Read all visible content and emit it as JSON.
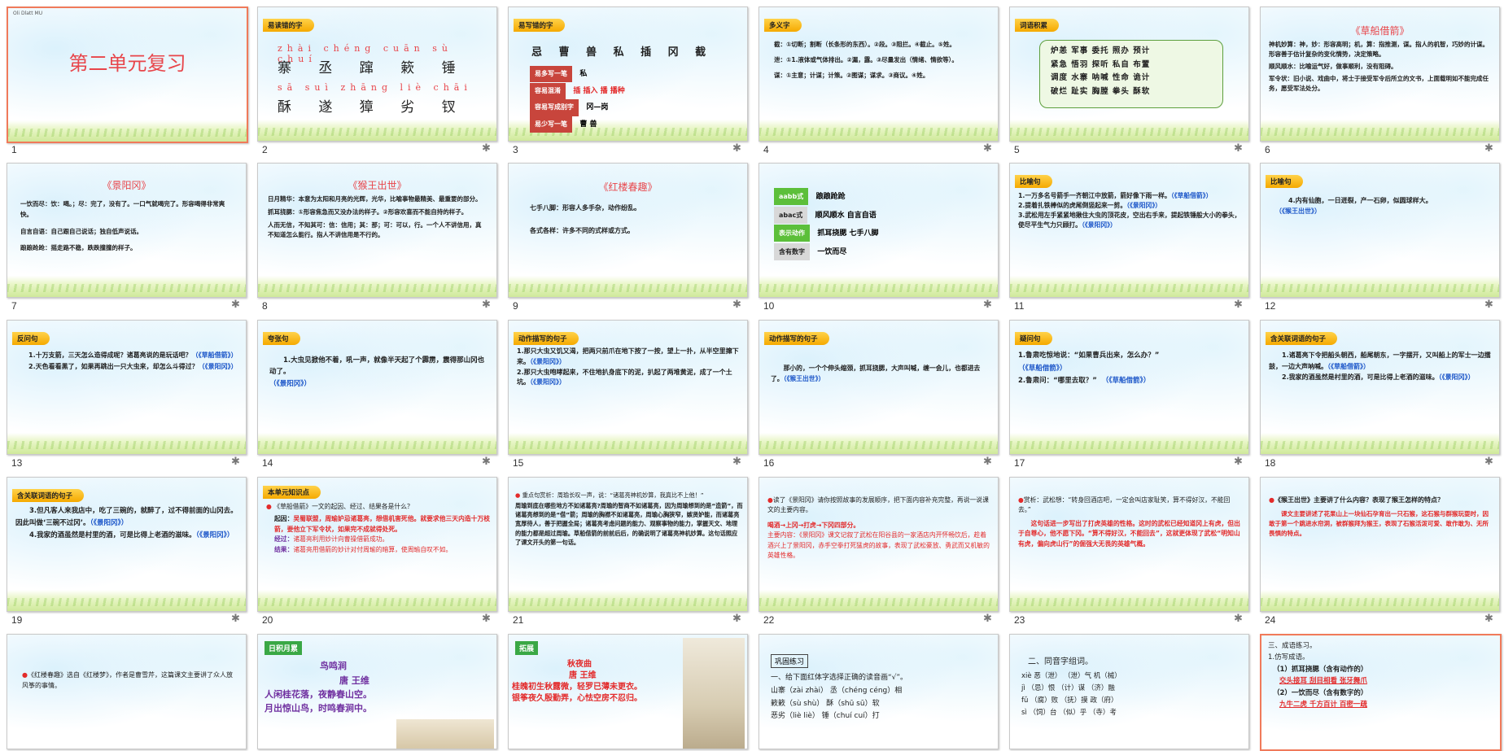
{
  "slides": [
    {
      "num": "1",
      "topline": "Oli  Dlatt  MU",
      "title": "第二单元复习"
    },
    {
      "num": "2",
      "tag": "易读错的字",
      "py1": "zhài  chéng cuān  sù   chuí",
      "ch1": "寨 丞 蹿 簌 锤",
      "py2": "sā   suì   zhāng   liè   chāi",
      "ch2": "酥 遂 獐 劣 钗"
    },
    {
      "num": "3",
      "tag": "易写错的字",
      "chars": "忌 曹 兽 私 插 冈 截",
      "rows": [
        {
          "label": "易多写一笔",
          "val": "私"
        },
        {
          "label": "容易混淆",
          "val": "插 插入  播 播种"
        },
        {
          "label": "容易写成别字",
          "val": "冈—岗"
        },
        {
          "label": "易少写一笔",
          "val": "曹  兽"
        }
      ]
    },
    {
      "num": "4",
      "tag": "多义字",
      "l1": "截：①切断；割断（长条形的东西）。②段。③阻拦。④截止。⑤姓。",
      "l2": "泄：①1.液体或气体排出。②漏，露。③尽量发出（情绪、情欲等）。",
      "l3": "谋：①主意；计谋；计策。②图谋；谋求。③商议。④姓。"
    },
    {
      "num": "5",
      "tag": "词语积累",
      "words": [
        "炉恙  军事  委托  照办  预计",
        "紧急  悟羽  探听  私自  布置",
        "调度  水寨  呐喊  性命  诡计",
        "破烂  趾实  胸膛  拳头  酥软"
      ]
    },
    {
      "num": "6",
      "title": "《草船借箭》",
      "p1": "神机妙算：神，妙：形容高明；机，算：指推测，谋。指人的机智，巧妙的计谋。形容善于估计复杂的变化情势，决定策略。",
      "p2": "顺风顺水：比喻运气好，做事顺利，没有阻碍。",
      "p3": "军令状：旧小说、戏曲中，将士于接受军令后所立的文书，上面载明如不能完成任务，愿受军法处分。"
    },
    {
      "num": "7",
      "title": "《景阳冈》",
      "p1": "一饮而尽：饮：喝。；尽：完了，没有了。一口气就喝完了。形容喝得非常爽快。",
      "p2": "自言自语：自己跟自己说话；独自低声说话。",
      "p3": "踉踉跄跄：摇走路不稳，跌跌撞撞的样子。"
    },
    {
      "num": "8",
      "title": "《猴王出世》",
      "p1": "日月精华：本意为太阳和月亮的光辉，光华，比喻事物最精美、最重要的部分。",
      "p2": "抓耳挠腮：①形容焦急而又没办法的样子。②形容欢喜而不能自持的样子。",
      "p3": "人而无信，不知其可：信：信用；其：那；可：可以，行。一个人不讲信用，真不知道怎么能行。指人不讲信用是不行的。"
    },
    {
      "num": "9",
      "title": "《红楼春趣》",
      "p1": "七手八脚：形容人多手杂，动作纷乱。",
      "p2": "各式各样：许多不同的式样或方式。"
    },
    {
      "num": "10",
      "rows": [
        {
          "label": "aabb式",
          "val": "踉踉跄跄"
        },
        {
          "label": "abac式",
          "val": "顺风顺水    自言自语"
        },
        {
          "label": "表示动作",
          "val": "抓耳挠腮    七手八脚"
        },
        {
          "label": "含有数字",
          "val": "一饮而尽"
        }
      ]
    },
    {
      "num": "11",
      "tag": "比喻句",
      "p1": "1.一万多名号箭手一齐朝江中放箭，箭好像下雨一样。",
      "s1": "（《草船借箭》）",
      "p2": "2.提着扎铁棒似的虎尾倒竖起来一剪。",
      "s2": "（《景阳冈》）",
      "p3": "3.武松用左手紧紧地揪住大虫的顶花皮，空出右手来，提起铁锤般大小的拳头，使尽平生气力只顾打。",
      "s3": "（《景阳冈》）"
    },
    {
      "num": "12",
      "tag": "比喻句",
      "p1": "4.内有仙胞，一日迸裂，产一石卵，似圆球样大。",
      "s1": "（《猴王出世》）"
    },
    {
      "num": "13",
      "tag": "反问句",
      "p1": "1.十万支箭，三天怎么造得成呢？诸葛亮说的是玩话吧？",
      "s1": "（《草船借箭》）",
      "p2": "2.天色看看黑了，如果再跳出一只大虫来，却怎么斗得过？",
      "s2": "（《景阳冈》）"
    },
    {
      "num": "14",
      "tag": "夸张句",
      "p1": "1.大虫见掀他不着，吼一声，就像半天起了个霹雳，震得那山冈也动了。",
      "s1": "（《景阳冈》）"
    },
    {
      "num": "15",
      "tag": "动作描写的句子",
      "p1": "1.那只大虫又饥又渴，把两只前爪在地下按了一按，望上一扑，从半空里撺下来。",
      "s1": "（《景阳冈》）",
      "p2": "2.那只大虫咆哮起来，不住地扒身底下的泥，扒起了两堆黄泥，成了一个土坑。",
      "s2": "（《景阳冈》）"
    },
    {
      "num": "16",
      "tag": "动作描写的句子",
      "p1": "那小的，一个个伸头缩颈，抓耳挠腮，大声叫喊，缠一会儿，也都进去了。",
      "s1": "（《猴王出世》）"
    },
    {
      "num": "17",
      "tag": "疑问句",
      "p1": "1.鲁肃吃惊地说：“如果曹兵出来，怎么办？”",
      "s1": "（《草船借箭》）",
      "p2": "2.鲁肃问：“哪里去取？”",
      "s2": "（《草船借箭》）"
    },
    {
      "num": "18",
      "tag": "含关联词语的句子",
      "p1": "1.诸葛亮下令把船头朝西，船尾朝东，一字摆开，又叫船上的军士一边擂鼓，一边大声呐喊。",
      "s1": "（《草船借箭》）",
      "p2": "2.我家的酒虽然是村里的酒，可是比得上老酒的滋味。",
      "s2": "（《景阳冈》）"
    },
    {
      "num": "19",
      "tag": "含关联词语的句子",
      "p1": "3.但凡客人来我店中，吃了三碗的，就醉了，过不得前面的山冈去。因此叫做‘三碗不过冈’。",
      "s1": "（《景阳冈》）",
      "p2": "4.我家的酒虽然是村里的酒，可是比得上老酒的滋味。",
      "s2": "（《景阳冈》）"
    },
    {
      "num": "20",
      "tag": "本单元知识点",
      "q": "《草船借箭》一文的起因、经过、结果各是什么？",
      "a1": "起因：",
      "a1v": "吴蜀联盟，周瑜妒忌诸葛亮，想借机害死他。就要求他三天内造十万枝箭，要他立下军令状，如果完不成就得处死。",
      "a2": "经过：",
      "a2v": "诸葛亮利用妙计向曹操借箭成功。",
      "a3": "结果：",
      "a3v": "诸葛亮用借箭的妙计对付周瑜的暗算，使周瑜自叹不如。"
    },
    {
      "num": "21",
      "p1": "重点句赏析：周瑜长叹一声，说：“诸葛亮神机妙算，我真比不上他！”",
      "p2": "周瑜到底在哪些地方不如诸葛亮?周瑜的智商不如诸葛亮，因为周瑜想到的是“造箭”，而诸葛亮想到的是“借”箭；周瑜的胸襟不如诸葛亮，周瑜心胸狭窄，嫉贤妒能，而诸葛亮宽厚待人，善于把握全局；诸葛亮考虑问题的能力、观察事物的能力，掌握天文、地理的能力都是超过周瑜。草船借箭的前前后后，的确说明了诸葛亮神机妙算。这句话照应了课文开头的第一句话。"
    },
    {
      "num": "22",
      "p1": "读了《景阳冈》请你按照故事的发展顺序，把下面内容补充完整，再说一说课文的主要内容。",
      "flow": "喝酒→上冈→打虎→下冈四部分。",
      "p2": "主要内容：《景阳冈》课文记叙了武松在阳谷县的一家酒店内开怀畅饮后，趁着酒兴上了景阳冈，赤手空拳打死猛虎的故事，表现了武松豪放、勇武而又机敏的英雄性格。"
    },
    {
      "num": "23",
      "p1": "赏析：武松想：“转身回酒店吧，一定会叫店家耻笑，算不得好汉，不能回去。”",
      "p2": "这句话进一步写出了打虎英雄的性格。这时的武松已经知道冈上有虎，但出于自尊心，他不愿下冈。“算不得好汉，不能回去”，这就更体现了武松“明知山有虎，偏向虎山行”的倔强大无畏的英雄气概。"
    },
    {
      "num": "24",
      "p1": "《猴王出世》主要讲了什么内容？表现了猴王怎样的特点？",
      "p2": "课文主要讲述了花果山上一块仙石孕育出一只石猴，这石猴与群猴玩耍时，因敢于第一个跳进水帘洞，被群猴拜为猴王，表现了石猴活泼可爱、敢作敢为、无所畏惧的特点。"
    },
    {
      "num": "25",
      "p1": "《红楼春趣》选自《红楼梦》，作者是曹雪芹，这篇课文主要讲了众人放风筝的事情。"
    },
    {
      "num": "26",
      "tag": "日积月累",
      "t": "鸟鸣涧",
      "a": "唐  王维",
      "l1": "人闲桂花落，夜静春山空。",
      "l2": "月出惊山鸟，时鸣春涧中。"
    },
    {
      "num": "27",
      "tag": "拓展",
      "t": "秋夜曲",
      "a": "唐  王维",
      "l1": "桂魄初生秋露微，轻罗已薄未更衣。",
      "l2": "银筝夜久殷勤弄，心怯空房不忍归。"
    },
    {
      "num": "28",
      "tag": "巩固练习",
      "q": "一、给下面红体字选择正确的读音画“√”。",
      "l1": "山寨（zài  zhài）  丞（chéng  céng）相",
      "l2": "簌簌（sù  shù）  酥（shū  sū）软",
      "l3": "恶劣（liè  liè）  锤（chuí  cuí）打"
    },
    {
      "num": "29",
      "q": "二、同音字组词。",
      "l1": "xiè   恶（泄）  （泄）气    机（械）",
      "l2": "jì    （忌）恨   （计）谋   （济）融",
      "l3": "fǔ    （腐）败   （抚）摸    政（府）",
      "l4": "sì    （饲）台   （似）乎   （寺）考"
    },
    {
      "num": "30",
      "q": "三、成语练习。",
      "s": "1.仿写成语。",
      "l1": "（1）抓耳挠腮（含有动作的）",
      "a1": "交头接耳    刮目相看    张牙舞爪",
      "l2": "（2）一饮而尽（含有数字的）",
      "a2": "九牛二虎    千方百计    百密一疏"
    }
  ]
}
